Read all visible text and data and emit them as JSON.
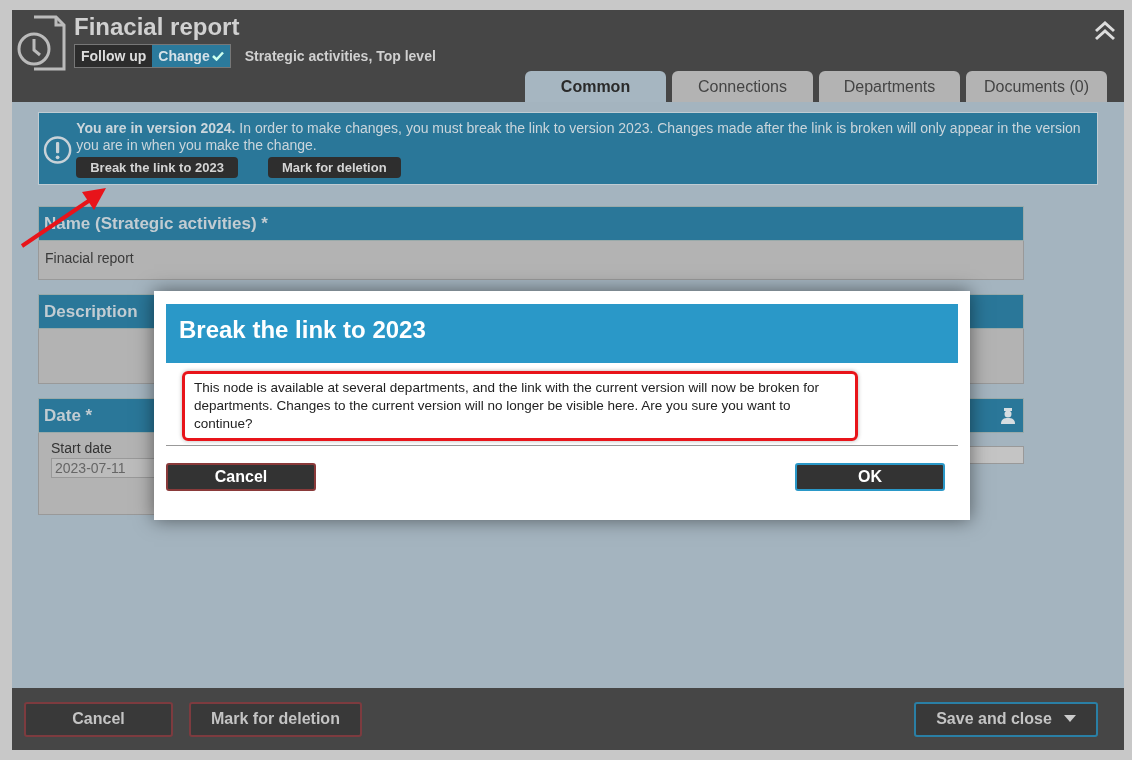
{
  "window": {
    "title": "Finacial report",
    "badges": [
      {
        "label": "Follow up",
        "selected": false
      },
      {
        "label": "Change",
        "selected": true
      }
    ],
    "breadcrumb": "Strategic activities, Top level"
  },
  "tabs": [
    {
      "label": "Common",
      "selected": true
    },
    {
      "label": "Connections",
      "selected": false
    },
    {
      "label": "Departments",
      "selected": false
    },
    {
      "label": "Documents (0)",
      "selected": false
    }
  ],
  "notice": {
    "text": "**You are in version 2024.** In order to make changes, you must break the link to version 2023. Changes made after the link is broken will only appear in the version you are in when you make the change.",
    "buttons": [
      "Break the link to 2023",
      "Mark for deletion"
    ]
  },
  "sections": [
    {
      "kind": "text",
      "label": "Name (Strategic activities) *",
      "value": "Finacial report"
    },
    {
      "kind": "empty",
      "label": "Description"
    },
    {
      "kind": "date",
      "label": "Date *",
      "fields": [
        {
          "label": "Start date",
          "value": "2023-07-11"
        }
      ]
    }
  ],
  "dialog": {
    "title": "Break the link to 2023",
    "message": "This node is available at several departments, and the link with the current version will now be broken for departments. Changes to the current version will no longer be visible here. Are you sure you want to continue?",
    "buttons": [
      {
        "label": "Cancel",
        "kind": "cancel"
      },
      {
        "label": "OK",
        "kind": "primary"
      }
    ]
  },
  "footer": {
    "buttons": [
      {
        "label": "Cancel",
        "kind": "cancel"
      },
      {
        "label": "Mark for deletion",
        "kind": "cancel"
      },
      {
        "label": "Save and close",
        "kind": "primary",
        "has_menu": true
      }
    ]
  }
}
